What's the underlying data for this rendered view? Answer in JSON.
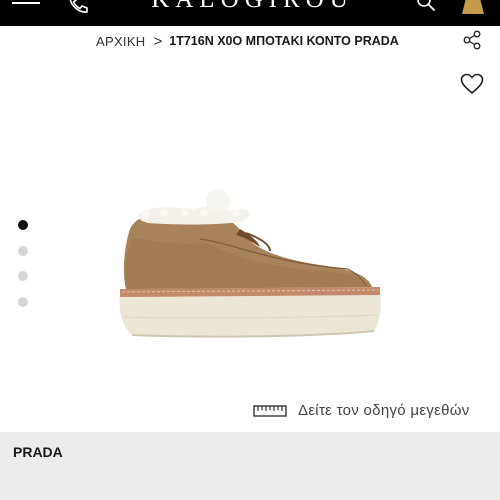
{
  "header": {
    "brand": "KALOGIROU",
    "icons": [
      "menu-icon",
      "phone-icon",
      "search-icon",
      "bag-icon"
    ],
    "background": "#000000",
    "bag_color": "#c49a4a"
  },
  "breadcrumb": {
    "home": "ΑΡΧΙΚΗ",
    "separator": ">",
    "current": "1T716N X0O ΜΠΟΤΑΚΙ ΚΟΝΤΟ PRADA"
  },
  "actions": {
    "share": "share-icon",
    "wishlist": "heart-icon"
  },
  "gallery": {
    "image": "suede platform boot with shearling lining",
    "slide_count": 4,
    "active_slide": 1
  },
  "size_guide": {
    "icon": "ruler-icon",
    "label": "Δείτε τον οδηγό μεγεθών"
  },
  "product": {
    "brand": "PRADA"
  }
}
